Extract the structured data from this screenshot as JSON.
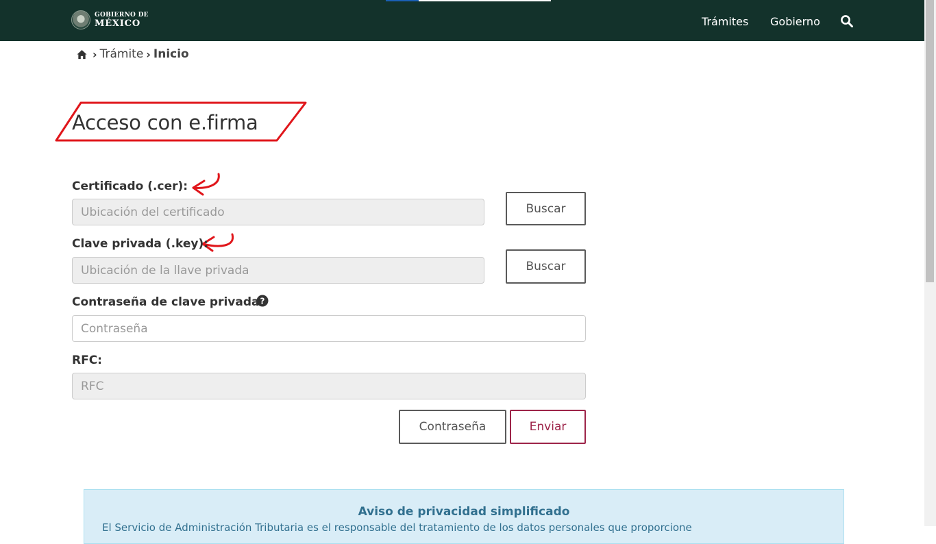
{
  "header": {
    "logo_line1": "GOBIERNO DE",
    "logo_line2": "MÉXICO",
    "nav": [
      "Trámites",
      "Gobierno"
    ],
    "search_icon": "search-icon",
    "colors": {
      "bar": "#13322b",
      "accent": "#1a5fb4"
    }
  },
  "breadcrumb": {
    "home_icon": "home-icon",
    "items": [
      "Trámite",
      "Inicio"
    ]
  },
  "page": {
    "title": "Acceso con e.firma"
  },
  "form": {
    "certificate_label": "Certificado (.cer):",
    "certificate_placeholder": "Ubicación del certificado",
    "certificate_button": "Buscar",
    "key_label": "Clave privada (.key):",
    "key_placeholder": "Ubicación de la llave privada",
    "key_button": "Buscar",
    "password_label": "Contraseña de clave privada:",
    "help_icon": "question-circle-icon",
    "password_placeholder": "Contraseña",
    "rfc_label": "RFC:",
    "rfc_placeholder": "RFC",
    "password_button": "Contraseña",
    "submit_button": "Enviar",
    "colors": {
      "primary": "#9d2449"
    }
  },
  "privacy": {
    "title": "Aviso de privacidad simplificado",
    "text": "El Servicio de Administración Tributaria es el responsable del tratamiento de los datos personales que proporcione"
  },
  "annotations": {
    "color": "#e0161b"
  }
}
